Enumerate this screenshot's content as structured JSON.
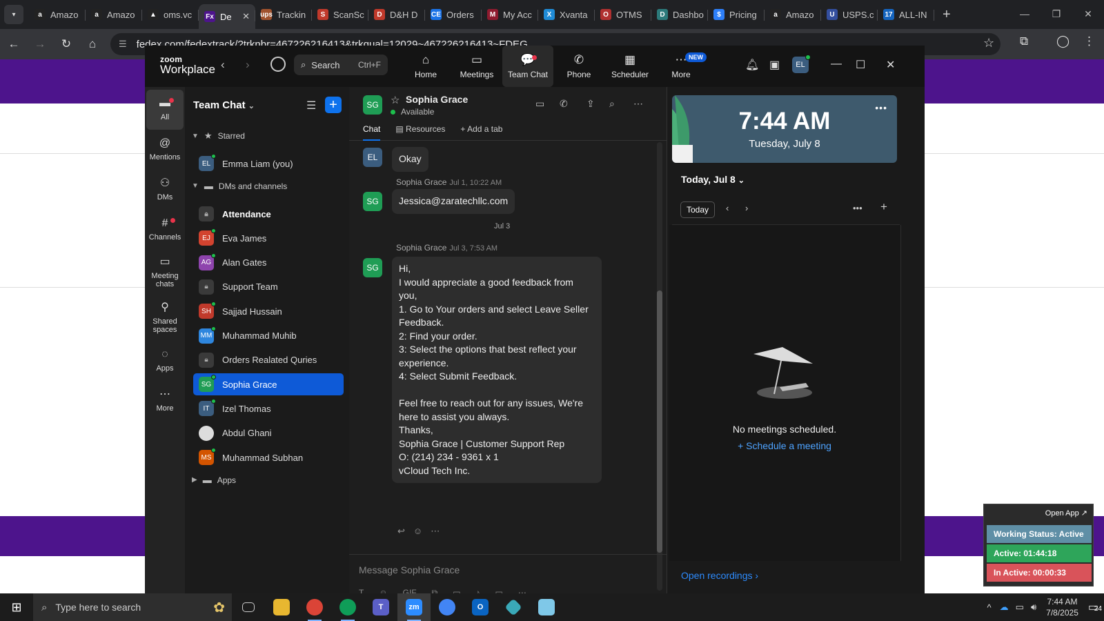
{
  "browser": {
    "tabs": [
      {
        "label": "Amazo",
        "color": "#222222",
        "glyph": "a"
      },
      {
        "label": "Amazo",
        "color": "#222222",
        "glyph": "a"
      },
      {
        "label": "oms.vc",
        "color": "#222222",
        "glyph": "▲"
      },
      {
        "label": "De",
        "color": "#4d148c",
        "glyph": "Fx",
        "active": true
      },
      {
        "label": "Trackin",
        "color": "#a0522d",
        "glyph": "ups"
      },
      {
        "label": "ScanSc",
        "color": "#c0392b",
        "glyph": "S"
      },
      {
        "label": "D&H D",
        "color": "#c0392b",
        "glyph": "D"
      },
      {
        "label": "Orders",
        "color": "#1a73e8",
        "glyph": "CE"
      },
      {
        "label": "My Acc",
        "color": "#8e1b2f",
        "glyph": "M"
      },
      {
        "label": "Xvanta",
        "color": "#1f8bd6",
        "glyph": "X"
      },
      {
        "label": "OTMS",
        "color": "#b03030",
        "glyph": "O"
      },
      {
        "label": "Dashbo",
        "color": "#2c7a7b",
        "glyph": "D"
      },
      {
        "label": "Pricing",
        "color": "#2d7ff9",
        "glyph": "$"
      },
      {
        "label": "Amazo",
        "color": "#222222",
        "glyph": "a"
      },
      {
        "label": "USPS.c",
        "color": "#334e9e",
        "glyph": "U"
      },
      {
        "label": "ALL-IN",
        "color": "#1565c0",
        "glyph": "17"
      }
    ],
    "url": "fedex.com/fedextrack/?trknbr=467226216413&trkqual=12029~467226216413~FDEG"
  },
  "zoom": {
    "logo_top": "zoom",
    "logo_bottom": "Workplace",
    "search_label": "Search",
    "search_shortcut": "Ctrl+F",
    "nav_tabs": [
      "Home",
      "Meetings",
      "Team Chat",
      "Phone",
      "Scheduler",
      "More"
    ],
    "new_badge": "NEW",
    "user_initials": "EL",
    "rail": [
      "All",
      "Mentions",
      "DMs",
      "Channels",
      "Meeting chats",
      "Shared spaces",
      "Apps",
      "More"
    ],
    "list_title": "Team Chat",
    "section_starred": "Starred",
    "section_dms": "DMs and channels",
    "section_apps": "Apps",
    "starred": [
      {
        "initials": "EL",
        "name": "Emma Liam (you)",
        "color": "#3b5d7f"
      }
    ],
    "contacts": [
      {
        "initials": "",
        "name": "Attendance",
        "color": "#3a3a3a",
        "lock": true,
        "bold": true
      },
      {
        "initials": "EJ",
        "name": "Eva James",
        "color": "#d2432f"
      },
      {
        "initials": "AG",
        "name": "Alan Gates",
        "color": "#8e44ad"
      },
      {
        "initials": "",
        "name": "Support Team",
        "color": "#3a3a3a",
        "lock": true
      },
      {
        "initials": "SH",
        "name": "Sajjad Hussain",
        "color": "#c0392b"
      },
      {
        "initials": "MM",
        "name": "Muhammad Muhib",
        "color": "#2e86de"
      },
      {
        "initials": "",
        "name": "Orders Realated Quries",
        "color": "#3a3a3a",
        "lock": true
      },
      {
        "initials": "SG",
        "name": "Sophia Grace",
        "color": "#1f9d55",
        "selected": true
      },
      {
        "initials": "IT",
        "name": "Izel Thomas",
        "color": "#3b5d7f"
      },
      {
        "initials": "",
        "name": "Abdul Ghani",
        "color": "#dddddd"
      },
      {
        "initials": "MS",
        "name": "Muhammad Subhan",
        "color": "#d35400"
      }
    ],
    "chat": {
      "contact_initials": "SG",
      "contact_name": "Sophia Grace",
      "status": "Available",
      "tabs": [
        "Chat",
        "Resources",
        "Add a tab"
      ],
      "messages": [
        {
          "initials": "EL",
          "sender": "",
          "time": "",
          "text": "Okay"
        },
        {
          "initials": "SG",
          "sender": "Sophia Grace",
          "time": "Jul 1, 10:22 AM",
          "text": "Jessica@zaratechllc.com"
        },
        {
          "initials": "SG",
          "sender": "Sophia Grace",
          "time": "Jul 3, 7:53 AM",
          "lines": [
            "Hi,",
            "I would appreciate a good feedback from",
            "you,",
            "1. Go to Your orders and select Leave Seller",
            "Feedback.",
            "2: Find your order.",
            "3: Select the options that best reflect your",
            "experience.",
            "4: Select Submit Feedback.",
            "",
            "Feel free to reach out for any issues, We're",
            "here to assist you always.",
            "Thanks,",
            "Sophia Grace | Customer Support Rep",
            "O: (214) 234 - 9361 x 1",
            "vCloud Tech Inc."
          ]
        }
      ],
      "date_separator": "Jul 3",
      "composer_placeholder": "Message Sophia Grace"
    },
    "calendar": {
      "time": "7:44 AM",
      "date": "Tuesday, July 8",
      "today_header": "Today, Jul 8",
      "today_button": "Today",
      "no_meetings": "No meetings scheduled.",
      "schedule_link": "Schedule a meeting",
      "open_recordings": "Open recordings"
    }
  },
  "widget": {
    "open_app": "Open App ↗",
    "working_status": "Working Status: Active",
    "active": "Active: 01:44:18",
    "inactive": "In Active: 00:00:33"
  },
  "taskbar": {
    "search_placeholder": "Type here to search",
    "time": "7:44 AM",
    "date": "7/8/2025",
    "notifications": "24"
  }
}
